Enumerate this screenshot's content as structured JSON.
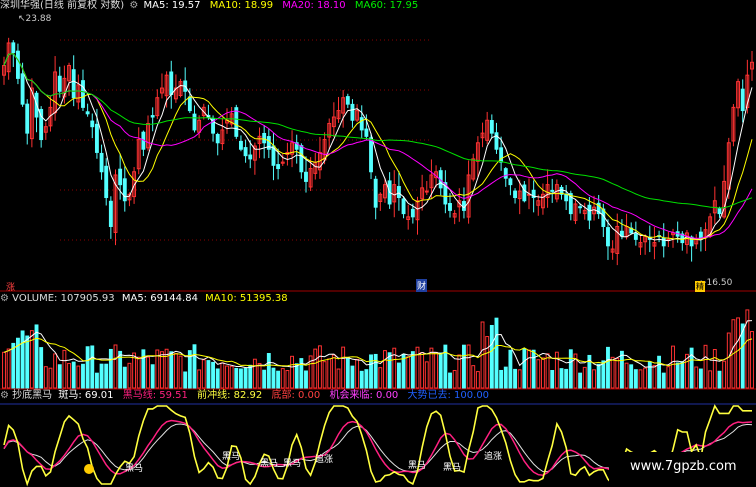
{
  "panel1": {
    "title": "深圳华强(日线 前复权 对数)",
    "ma5": {
      "label": "MA5: 19.57",
      "color": "#ffffff"
    },
    "ma10": {
      "label": "MA10: 18.99",
      "color": "#ffff00"
    },
    "ma20": {
      "label": "MA20: 18.10",
      "color": "#ff00ff"
    },
    "ma60": {
      "label": "MA60: 17.95",
      "color": "#00e000"
    },
    "high_label": "23.88",
    "low_label": "16.50",
    "marker_zhang": "涨",
    "marker_cai": "财",
    "marker_jing": "精"
  },
  "panel2": {
    "volume": "VOLUME: 107905.93",
    "ma5": "MA5: 69144.84",
    "ma10": "MA10: 51395.38"
  },
  "panel3": {
    "name": "抄底黑马",
    "banma": "斑马: 69.01",
    "heima_line": "黑马线: 59.51",
    "qianchong": "前冲线: 82.92",
    "dibu": "底部: 0.00",
    "jihui": "机会来临: 0.00",
    "dashi": "大势已去: 100.00",
    "labels": [
      "黑马",
      "黑马",
      "黑马",
      "黑马",
      "追涨",
      "黑马",
      "黑马",
      "追涨"
    ],
    "watermark": "www.7gpzb.com"
  },
  "colors": {
    "up": "#ff3232",
    "down": "#54ffff",
    "grid": "#8b0000",
    "ma5": "#ffffff",
    "ma10": "#ffff00",
    "ma20": "#ff00ff",
    "ma60": "#00e000"
  },
  "chart_data": {
    "type": "candlestick",
    "price_high_label": 23.88,
    "price_low_label": 16.5,
    "ylim": [
      16.0,
      24.2
    ],
    "close": [
      22.6,
      23.3,
      23.0,
      22.2,
      21.4,
      20.5,
      21.9,
      21.0,
      20.3,
      20.7,
      21.3,
      22.4,
      21.8,
      22.2,
      22.6,
      21.6,
      22.0,
      21.3,
      21.1,
      20.7,
      19.9,
      19.3,
      18.5,
      17.6,
      19.2,
      18.9,
      18.4,
      18.6,
      19.3,
      20.3,
      20.0,
      20.8,
      21.0,
      21.6,
      21.9,
      22.3,
      21.7,
      21.9,
      22.1,
      21.8,
      21.2,
      20.6,
      20.9,
      21.3,
      21.0,
      20.5,
      20.2,
      20.6,
      20.9,
      21.1,
      20.4,
      20.0,
      19.8,
      19.7,
      20.1,
      20.4,
      20.2,
      20.0,
      19.5,
      19.4,
      19.6,
      19.9,
      20.2,
      20.0,
      19.3,
      19.0,
      19.4,
      19.6,
      19.9,
      20.3,
      20.8,
      21.0,
      21.2,
      21.6,
      21.4,
      20.9,
      21.2,
      20.6,
      20.4,
      19.3,
      18.2,
      18.6,
      18.9,
      18.3,
      18.9,
      18.5,
      18.0,
      17.9,
      17.9,
      18.4,
      18.8,
      18.7,
      19.2,
      19.3,
      18.8,
      18.3,
      18.1,
      18.0,
      18.4,
      18.1,
      19.2,
      19.7,
      20.2,
      20.5,
      20.9,
      20.5,
      20.0,
      19.6,
      19.1,
      18.9,
      18.5,
      18.7,
      18.4,
      18.6,
      18.5,
      18.4,
      18.6,
      18.9,
      18.7,
      18.9,
      18.6,
      18.4,
      18.0,
      18.3,
      18.2,
      18.1,
      17.8,
      18.2,
      18.0,
      17.6,
      17.0,
      16.9,
      17.6,
      17.3,
      17.6,
      17.4,
      17.2,
      17.1,
      17.3,
      17.2,
      17.1,
      17.3,
      17.0,
      17.2,
      17.4,
      17.3,
      17.1,
      17.4,
      17.0,
      17.2,
      17.2,
      17.5,
      17.9,
      18.4,
      18.0,
      19.0,
      20.2,
      21.3,
      22.1,
      21.2,
      22.3,
      22.7
    ],
    "ma5": 19.57,
    "ma10": 18.99,
    "ma20": 18.1,
    "ma60": 17.95,
    "volume": 107905.93,
    "vol_ma5": 69144.84,
    "vol_ma10": 51395.38,
    "indicator": {
      "banma": 69.01,
      "heima_line": 59.51,
      "qianchong": 82.92,
      "dibu": 0.0,
      "jihui": 0.0,
      "dashi": 100.0
    }
  }
}
